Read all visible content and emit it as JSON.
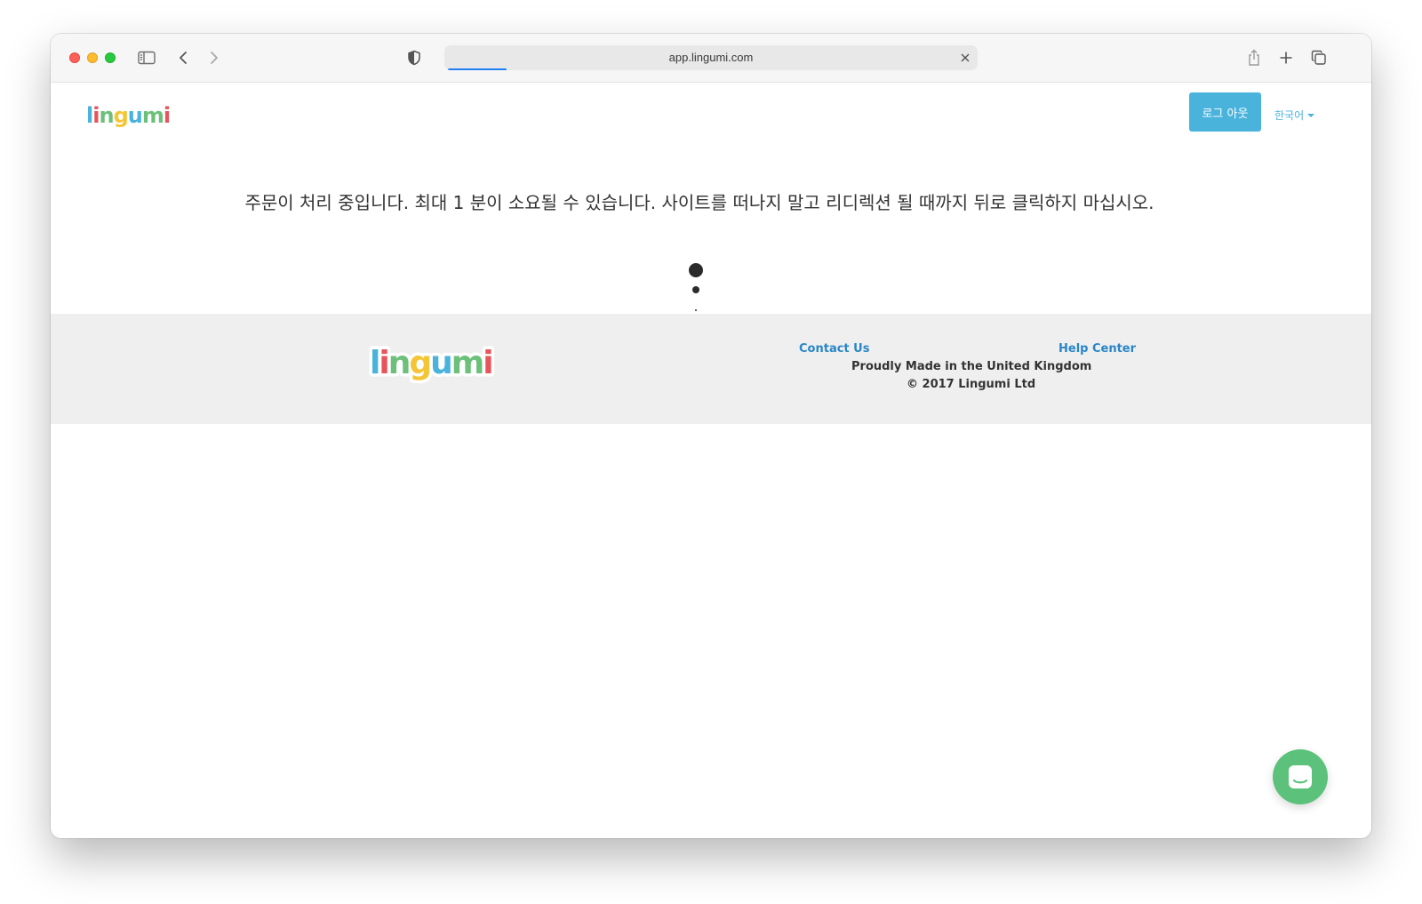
{
  "browser": {
    "url": "app.lingumi.com",
    "load_progress": 0.11
  },
  "header": {
    "logo_text": "lingumi",
    "logout_label": "로그 아웃",
    "language_label": "한국어"
  },
  "main": {
    "status_message": "주문이 처리 중입니다. 최대 1 분이 소요될 수 있습니다. 사이트를 떠나지 말고 리디렉션 될 때까지 뒤로 클릭하지 마십시오."
  },
  "footer": {
    "logo_text": "lingumi",
    "contact_label": "Contact Us",
    "help_label": "Help Center",
    "made_in": "Proudly Made in the United Kingdom",
    "copyright": "© 2017 Lingumi Ltd"
  },
  "colors": {
    "accent": "#4ab3dc",
    "link": "#2a86c7",
    "chat": "#5cc27b",
    "footer_bg": "#efefef"
  },
  "icons": {
    "toolbar": [
      "sidebar-icon",
      "back-icon",
      "forward-icon",
      "shield-icon",
      "share-icon",
      "new-tab-icon",
      "tabs-overview-icon"
    ],
    "chat": "chat-bubble-icon"
  }
}
